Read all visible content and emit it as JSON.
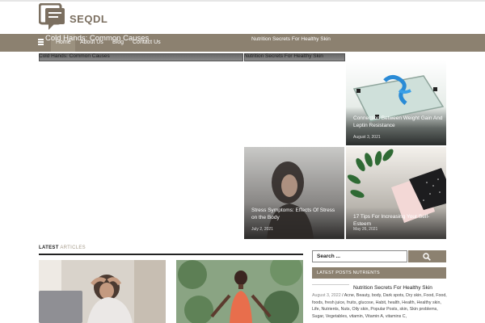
{
  "header": {
    "brand": "SEQDL"
  },
  "nav": {
    "items": [
      {
        "label": "Home"
      },
      {
        "label": "About Us"
      },
      {
        "label": "Blog"
      },
      {
        "label": "Contact Us"
      }
    ],
    "left_title": "Cold Hands: Common Causes",
    "right_title": "Nutrition Secrets For Healthy Skin"
  },
  "tickers": [
    {
      "label": "Cold Hands: Common Causes"
    },
    {
      "label": "Nutrition Secrets For Healthy Skin"
    }
  ],
  "featured": [
    {
      "title": "Connection Between Weight Gain And Leptin Resistance",
      "date": "August 3, 2021"
    },
    {
      "title": "Stress Symptoms: Effects Of Stress on the Body",
      "date": "July 2, 2021"
    },
    {
      "title": "17 Tips For Increasing Your Self-Esteem",
      "date": "May 26, 2021"
    }
  ],
  "section": {
    "label_strong": "LATEST",
    "label_muted": " ARTICLES"
  },
  "sidebar": {
    "search_label": "Search ...",
    "latest_posts_label": "LATEST POSTS NUTRIENTS",
    "post": {
      "title": "Nutrition Secrets For Healthy Skin",
      "date": "August 3, 2022",
      "tags": " / Acne, Beauty, body, Dark spots, Dry skin, Food, Food, foods, fresh juice, fruits, glucose, Habit, health, Health, Healthy skin, Life, Nutrients, Nuts, Oily skin, Popular Posts, skin, Skin problems, Sugar, Vegetables, vitamin, Vitamin A, vitamins C,"
    }
  },
  "colors": {
    "accent": "#8c8170",
    "brand_text": "#7b6f60"
  }
}
